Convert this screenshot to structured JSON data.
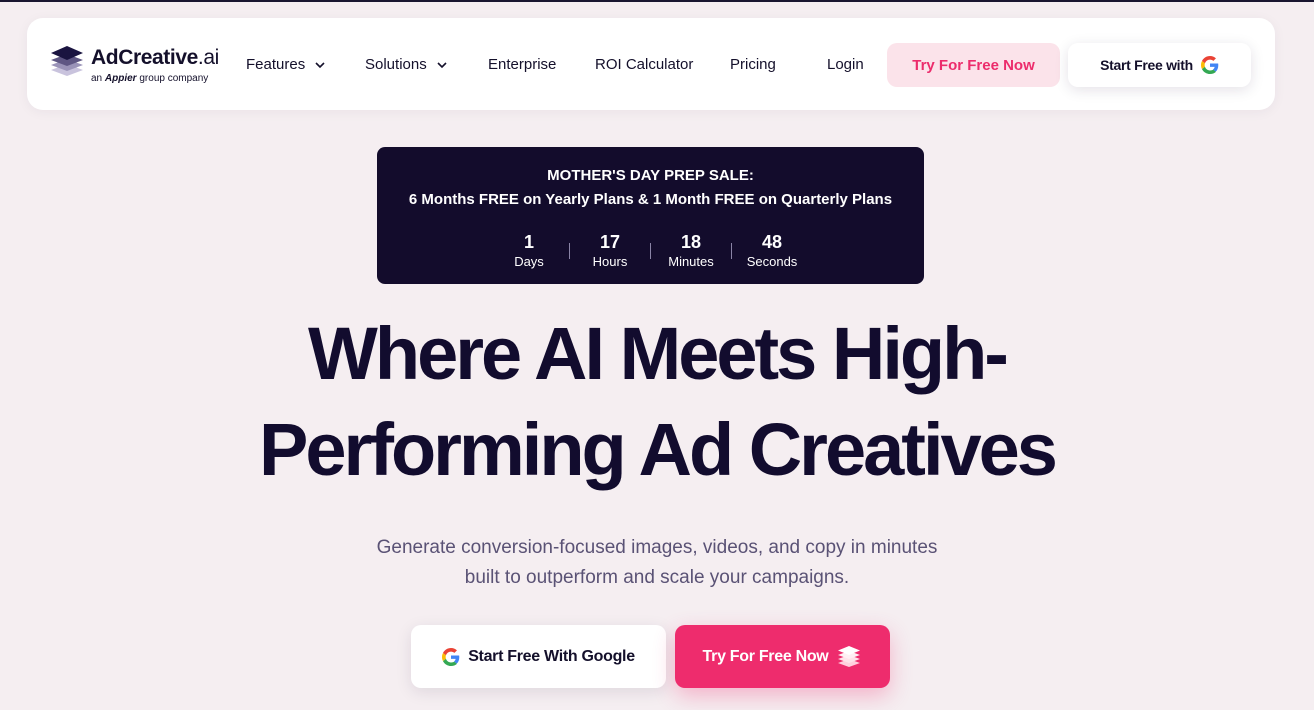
{
  "brand": {
    "name_main": "AdCreative",
    "name_suffix": ".ai",
    "sub_prefix": "an",
    "sub_company": "Appier",
    "sub_suffix": "group company"
  },
  "nav": {
    "features": "Features",
    "solutions": "Solutions",
    "enterprise": "Enterprise",
    "roi_calculator": "ROI Calculator",
    "pricing": "Pricing",
    "login": "Login",
    "try_free": "Try For Free Now",
    "start_free_with": "Start Free with"
  },
  "promo": {
    "title": "MOTHER'S DAY PREP SALE:",
    "subtitle": "6 Months FREE on Yearly Plans & 1 Month FREE on Quarterly Plans",
    "countdown": [
      {
        "value": "1",
        "label": "Days"
      },
      {
        "value": "17",
        "label": "Hours"
      },
      {
        "value": "18",
        "label": "Minutes"
      },
      {
        "value": "48",
        "label": "Seconds"
      }
    ]
  },
  "hero": {
    "headline_line1": "Where AI Meets High-",
    "headline_line2": "Performing Ad Creatives",
    "description_line1": "Generate conversion-focused images, videos, and copy in minutes",
    "description_line2": "built to outperform and scale your campaigns.",
    "cta_google": "Start Free With Google",
    "cta_try": "Try For Free Now"
  },
  "colors": {
    "accent_pink": "#ee2c6d",
    "navy": "#130c2c",
    "page_bg": "#f5eef1"
  },
  "icons": {
    "logo": "stacked-layers-logo",
    "google": "google-g-icon",
    "chevron": "chevron-down-icon",
    "cta": "stacked-layers-icon"
  }
}
